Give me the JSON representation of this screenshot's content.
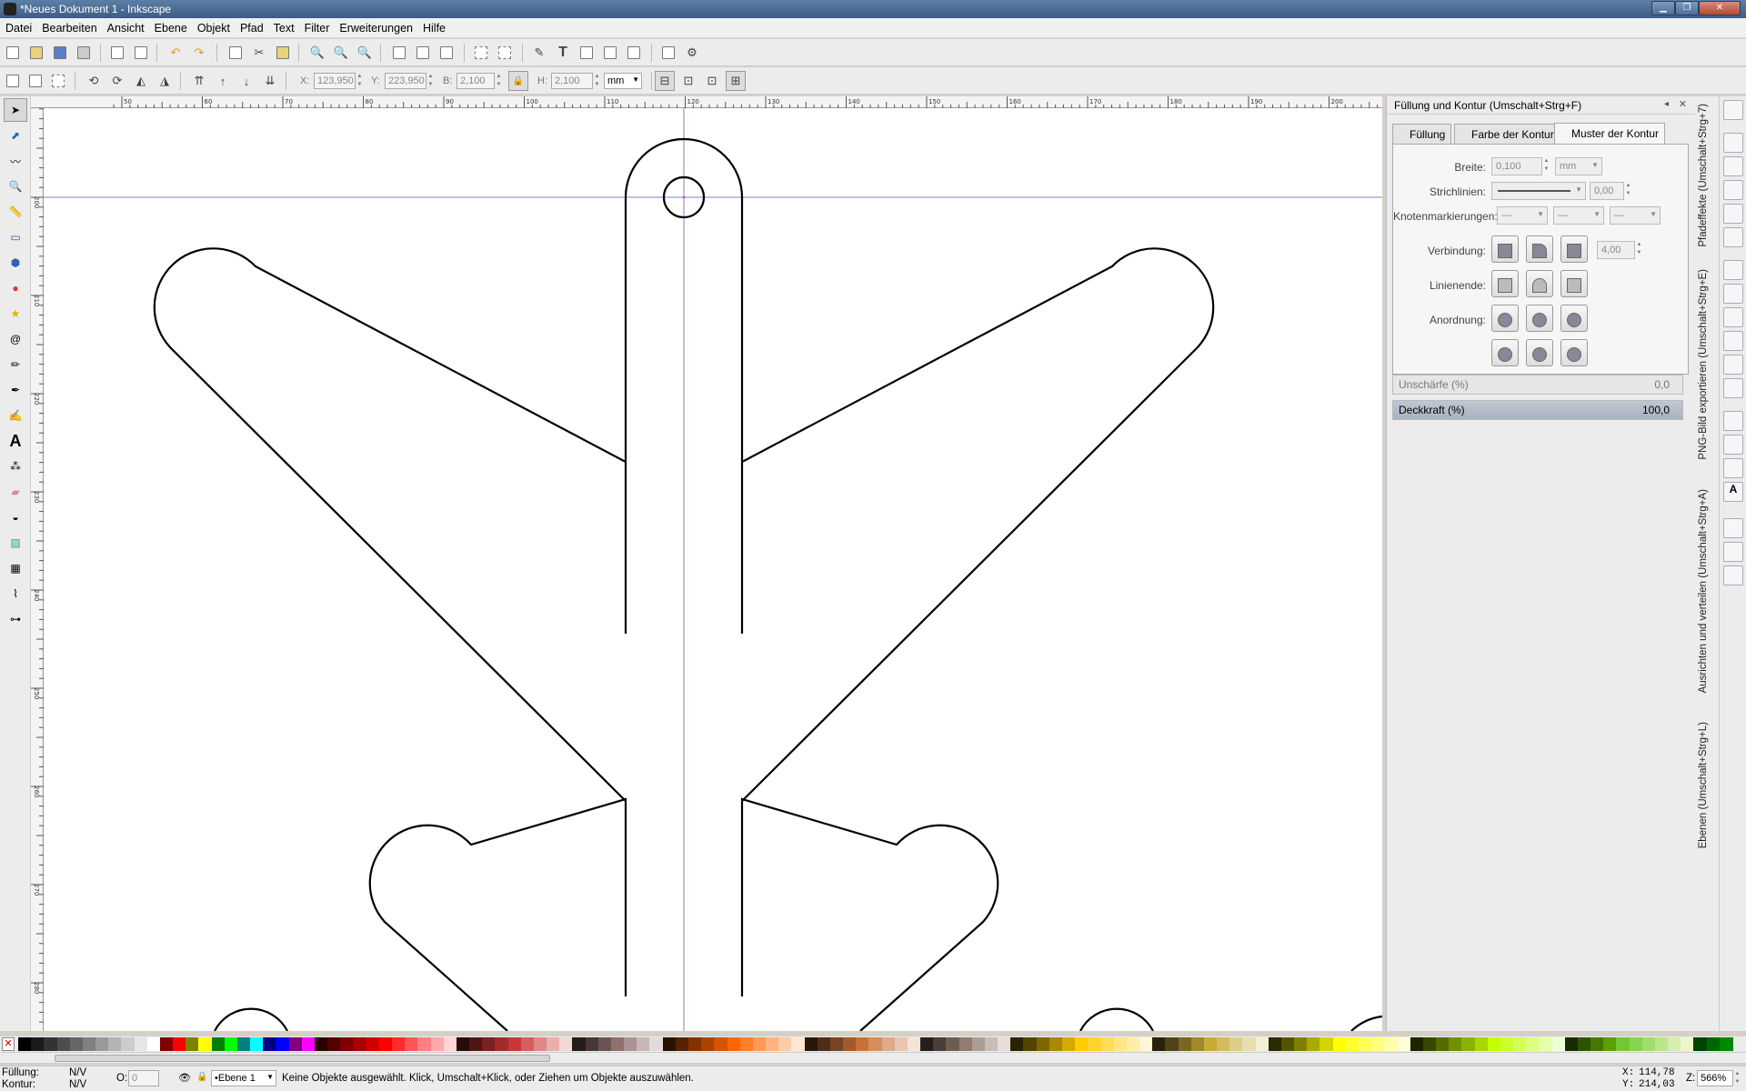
{
  "window": {
    "title": "*Neues Dokument 1 - Inkscape",
    "buttons": [
      "▁",
      "❐",
      "✕"
    ]
  },
  "menu": [
    "Datei",
    "Bearbeiten",
    "Ansicht",
    "Ebene",
    "Objekt",
    "Pfad",
    "Text",
    "Filter",
    "Erweiterungen",
    "Hilfe"
  ],
  "toolcontrols": {
    "x_label": "X:",
    "x_value": "123,950",
    "y_label": "Y:",
    "y_value": "223,950",
    "w_label": "B:",
    "w_value": "2,100",
    "h_label": "H:",
    "h_value": "2,100",
    "unit": "mm"
  },
  "panel": {
    "title": "Füllung und Kontur (Umschalt+Strg+F)",
    "tabs": [
      "Füllung",
      "Farbe der Kontur",
      "Muster der Kontur"
    ],
    "active_tab": 2,
    "width_label": "Breite:",
    "width_value": "0,100",
    "width_unit": "mm",
    "dash_label": "Strichlinien:",
    "dash_offset": "0,00",
    "markers_label": "Knotenmarkierungen:",
    "join_label": "Verbindung:",
    "miter_value": "4,00",
    "cap_label": "Linienende:",
    "order_label": "Anordnung:",
    "blur_label": "Unschärfe (%)",
    "blur_value": "0,0",
    "opacity_label": "Deckkraft (%)",
    "opacity_value": "100,0"
  },
  "dock_tabs": [
    "Pfadeffekte (Umschalt+Strg+7)",
    "PNG-Bild exportieren (Umschalt+Strg+E)",
    "Ausrichten und verteilen (Umschalt+Strg+A)",
    "Ebenen (Umschalt+Strg+L)"
  ],
  "ruler": {
    "top_labels": [
      "50",
      "60",
      "70",
      "80",
      "90",
      "100",
      "110",
      "120",
      "130",
      "140",
      "150",
      "160",
      "170",
      "180",
      "190",
      "200"
    ],
    "left_labels": [
      "200",
      "210",
      "220",
      "230",
      "240",
      "250",
      "260",
      "270",
      "280",
      "290"
    ]
  },
  "status": {
    "fill_label": "Füllung:",
    "fill_value": "N/V",
    "stroke_label": "Kontur:",
    "stroke_value": "N/V",
    "opacity_label": "O:",
    "opacity_value": "0",
    "layer": "•Ebene 1",
    "message": "Keine Objekte ausgewählt. Klick, Umschalt+Klick, oder Ziehen um Objekte auszuwählen.",
    "cursor_x_label": "X:",
    "cursor_x": "114,78",
    "cursor_y_label": "Y:",
    "cursor_y": "214,03",
    "zoom_label": "Z:",
    "zoom": "566%"
  },
  "palette_colors": [
    "#000000",
    "#1a1a1a",
    "#333333",
    "#4d4d4d",
    "#666666",
    "#808080",
    "#999999",
    "#b3b3b3",
    "#cccccc",
    "#e6e6e6",
    "#ffffff",
    "#800000",
    "#ff0000",
    "#808000",
    "#ffff00",
    "#008000",
    "#00ff00",
    "#008080",
    "#00ffff",
    "#000080",
    "#0000ff",
    "#800080",
    "#ff00ff",
    "#2b0000",
    "#550000",
    "#800000",
    "#aa0000",
    "#d40000",
    "#ff0000",
    "#ff2a2a",
    "#ff5555",
    "#ff8080",
    "#ffaaaa",
    "#ffd5d5",
    "#280b0b",
    "#501616",
    "#782121",
    "#a02c2c",
    "#c83737",
    "#d35f5f",
    "#de8787",
    "#e9afaf",
    "#f4d7d7",
    "#241c1c",
    "#483737",
    "#6c5353",
    "#916f6f",
    "#ac9393",
    "#c8b7b7",
    "#e3dbdb",
    "#2b1100",
    "#552200",
    "#803300",
    "#aa4400",
    "#d45500",
    "#ff6600",
    "#ff7f2a",
    "#ff9955",
    "#ffb380",
    "#ffccaa",
    "#ffe6d5",
    "#28170b",
    "#502d16",
    "#784421",
    "#a05a2c",
    "#c87137",
    "#d38d5f",
    "#deaa87",
    "#e9c6af",
    "#f4e3d7",
    "#241f1c",
    "#483e37",
    "#6c5d53",
    "#917c6f",
    "#ac9d93",
    "#c8beb7",
    "#e3dedb",
    "#2b2200",
    "#554400",
    "#806600",
    "#aa8800",
    "#d4aa00",
    "#ffcc00",
    "#ffd42a",
    "#ffdd55",
    "#ffe680",
    "#ffeeaa",
    "#fff6d5",
    "#28220b",
    "#504416",
    "#786721",
    "#a0892c",
    "#c8ab37",
    "#d3bc5f",
    "#decd87",
    "#e9ddaf",
    "#f4eed7",
    "#2b2b00",
    "#555500",
    "#808000",
    "#aaaa00",
    "#d4d400",
    "#ffff00",
    "#ffff2a",
    "#ffff55",
    "#ffff80",
    "#ffffaa",
    "#ffffd5",
    "#1c2400",
    "#364800",
    "#556b00",
    "#728f00",
    "#89b300",
    "#abd600",
    "#c4ff00",
    "#ccff2a",
    "#d4ff55",
    "#ddff80",
    "#e5ffaa",
    "#eeffd5",
    "#162b00",
    "#2c5500",
    "#447800",
    "#5aa000",
    "#71c837",
    "#88d44f",
    "#a1dc6e",
    "#bbe58d",
    "#d4eeac",
    "#edf7cc",
    "#004400",
    "#006600",
    "#008800"
  ]
}
